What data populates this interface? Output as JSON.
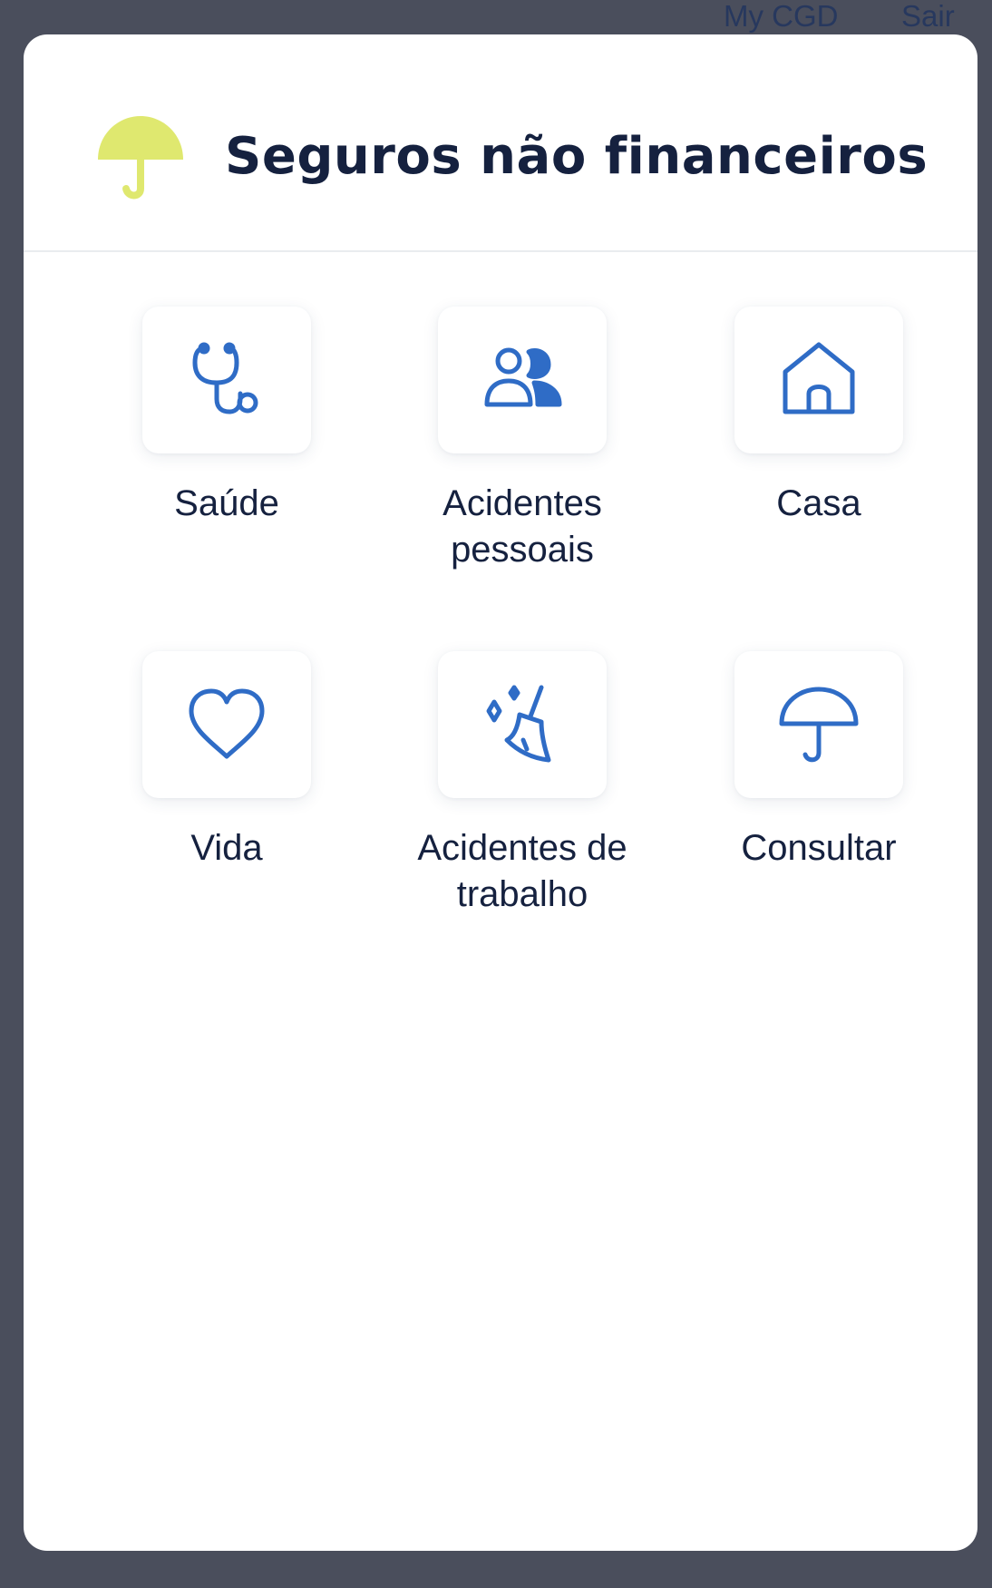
{
  "top_nav": {
    "my_cgd": "My CGD",
    "sair": "Sair"
  },
  "header": {
    "title": "Seguros não financeiros",
    "icon": "umbrella-icon",
    "icon_color": "#dfe86f"
  },
  "colors": {
    "accent": "#2f6cc6",
    "text": "#15213f",
    "backdrop": "#4a4e5c"
  },
  "options": [
    {
      "label": "Saúde",
      "icon": "stethoscope-icon"
    },
    {
      "label": "Acidentes pessoais",
      "icon": "people-icon"
    },
    {
      "label": "Casa",
      "icon": "house-icon"
    },
    {
      "label": "Vida",
      "icon": "heart-icon"
    },
    {
      "label": "Acidentes de trabalho",
      "icon": "broom-icon"
    },
    {
      "label": "Consultar",
      "icon": "umbrella-icon"
    }
  ]
}
